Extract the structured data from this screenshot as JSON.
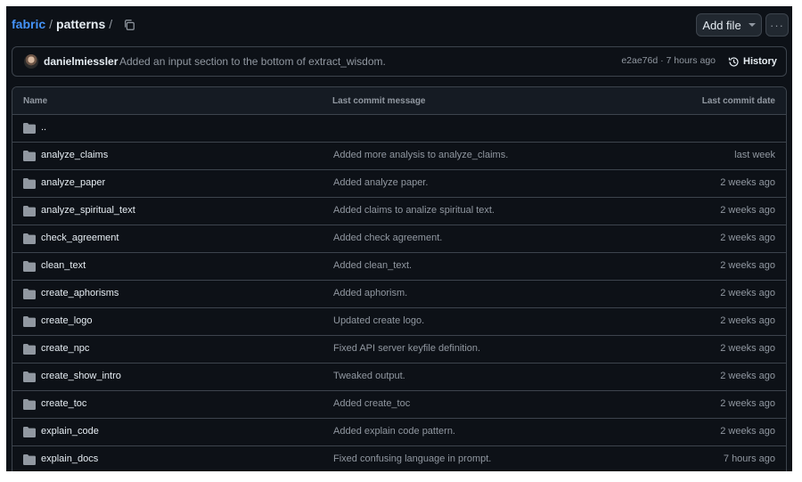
{
  "breadcrumb": {
    "repo": "fabric",
    "sep1": "/",
    "folder": "patterns",
    "sep2": "/"
  },
  "toolbar": {
    "add_file_label": "Add file",
    "more_label": "···"
  },
  "latest_commit": {
    "author": "danielmiessler",
    "message": "Added an input section to the bottom of extract_wisdom.",
    "hash_time": "e2ae76d · 7 hours ago",
    "history_label": "History"
  },
  "table": {
    "headers": [
      "Name",
      "Last commit message",
      "Last commit date"
    ],
    "parent_dir": "..",
    "rows": [
      {
        "name": "analyze_claims",
        "message": "Added more analysis to analyze_claims.",
        "date": "last week"
      },
      {
        "name": "analyze_paper",
        "message": "Added analyze paper.",
        "date": "2 weeks ago"
      },
      {
        "name": "analyze_spiritual_text",
        "message": "Added claims to analize spiritual text.",
        "date": "2 weeks ago"
      },
      {
        "name": "check_agreement",
        "message": "Added check agreement.",
        "date": "2 weeks ago"
      },
      {
        "name": "clean_text",
        "message": "Added clean_text.",
        "date": "2 weeks ago"
      },
      {
        "name": "create_aphorisms",
        "message": "Added aphorism.",
        "date": "2 weeks ago"
      },
      {
        "name": "create_logo",
        "message": "Updated create logo.",
        "date": "2 weeks ago"
      },
      {
        "name": "create_npc",
        "message": "Fixed API server keyfile definition.",
        "date": "2 weeks ago"
      },
      {
        "name": "create_show_intro",
        "message": "Tweaked output.",
        "date": "2 weeks ago"
      },
      {
        "name": "create_toc",
        "message": "Added create_toc",
        "date": "2 weeks ago"
      },
      {
        "name": "explain_code",
        "message": "Added explain code pattern.",
        "date": "2 weeks ago"
      },
      {
        "name": "explain_docs",
        "message": "Fixed confusing language in prompt.",
        "date": "7 hours ago"
      }
    ]
  },
  "icons": {
    "copy": "copy-icon",
    "history": "history-icon",
    "folder": "folder-icon",
    "chevron": "chevron-down-icon"
  },
  "colors": {
    "background": "#0d1117",
    "link": "#4493f8",
    "border": "#3d444d",
    "muted_text": "#9198a1",
    "folder": "#9198a1"
  }
}
